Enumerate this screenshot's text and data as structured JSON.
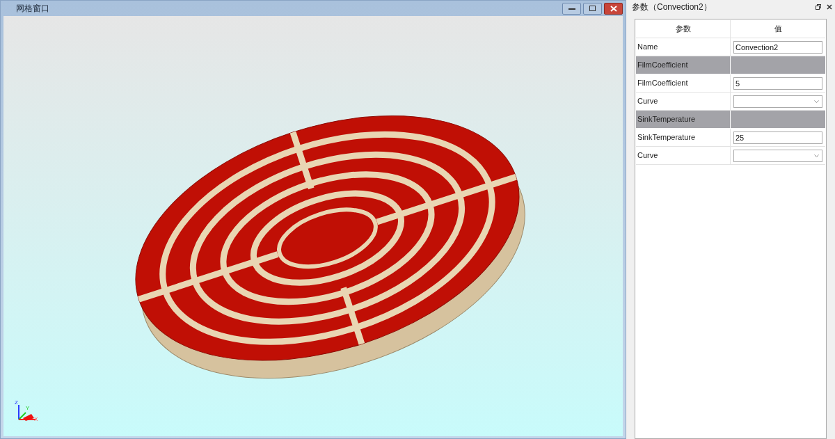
{
  "mesh_window": {
    "title": "网格窗口",
    "axes": [
      "Z",
      "Y",
      "X"
    ]
  },
  "panel": {
    "title": "参数（Convection2）",
    "columns": [
      "参数",
      "值"
    ],
    "rows": [
      {
        "kind": "field",
        "label": "Name",
        "value": "Convection2"
      },
      {
        "kind": "group",
        "label": "FilmCoefficient"
      },
      {
        "kind": "field",
        "label": "FilmCoefficient",
        "value": "5"
      },
      {
        "kind": "dropdown",
        "label": "Curve"
      },
      {
        "kind": "group",
        "label": "SinkTemperature"
      },
      {
        "kind": "field",
        "label": "SinkTemperature",
        "value": "25"
      },
      {
        "kind": "dropdown",
        "label": "Curve"
      }
    ]
  }
}
